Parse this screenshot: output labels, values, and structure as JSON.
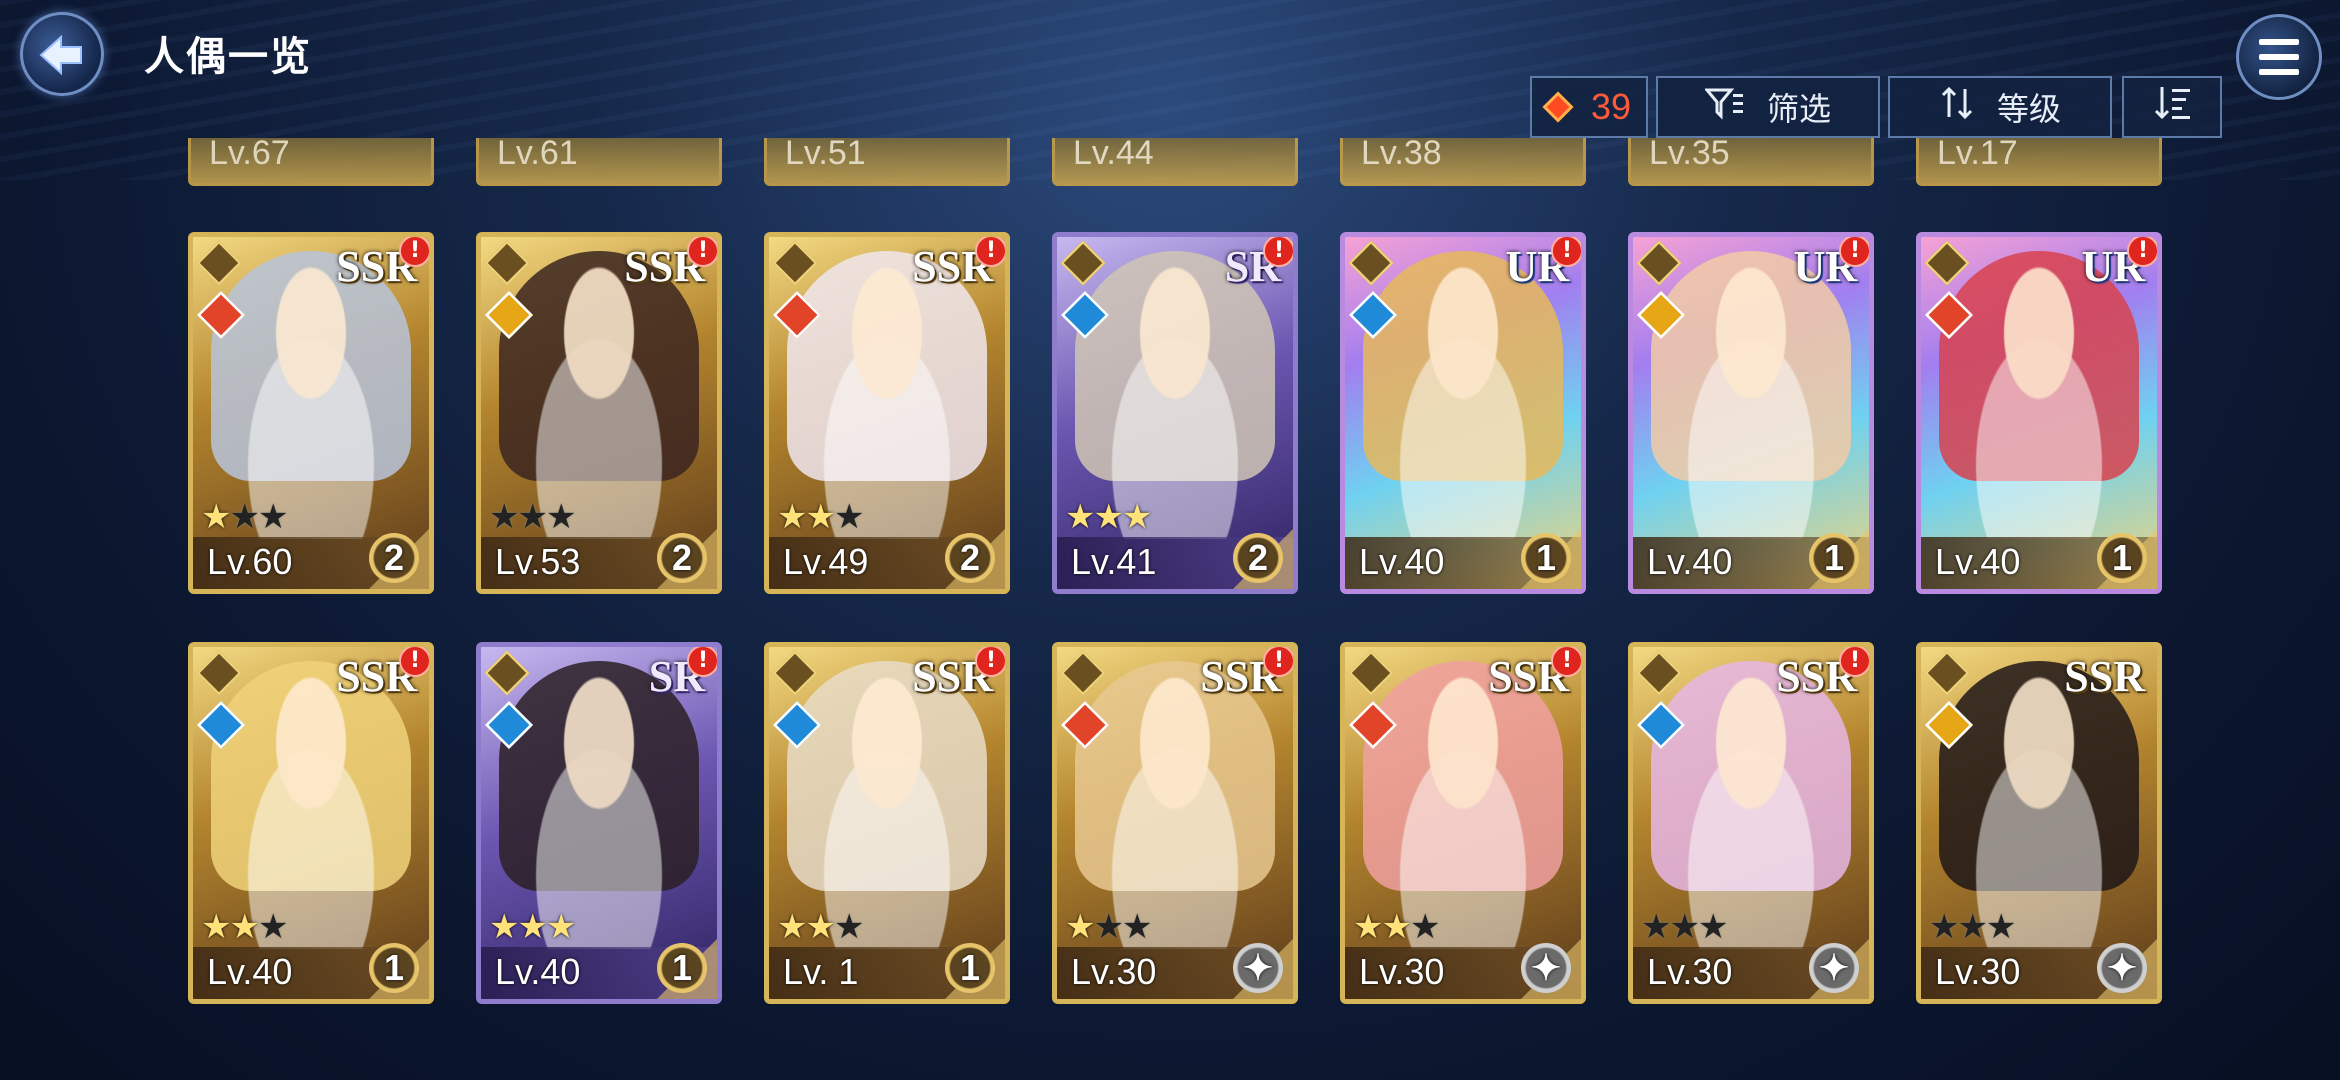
{
  "header": {
    "title": "人偶一览",
    "back_icon": "back-arrow-icon",
    "menu_icon": "hamburger-menu-icon"
  },
  "toolbar": {
    "currency_value": "39",
    "filter_label": "筛选",
    "sort_label": "等级",
    "order_icon": "sort-descending-icon"
  },
  "top_row_levels": [
    "Lv.67",
    "Lv.61",
    "Lv.51",
    "Lv.44",
    "Lv.38",
    "Lv.35",
    "Lv.17"
  ],
  "cards": [
    {
      "level": "Lv.60",
      "rarity": "SSR",
      "badge": "2",
      "stars_on": 1,
      "element": "fire",
      "frame": "gold",
      "hair": "#b7c4da"
    },
    {
      "level": "Lv.53",
      "rarity": "SSR",
      "badge": "2",
      "stars_on": 0,
      "element": "earth",
      "frame": "gold",
      "hair": "#3b2420"
    },
    {
      "level": "Lv.49",
      "rarity": "SSR",
      "badge": "2",
      "stars_on": 2,
      "element": "fire",
      "frame": "gold",
      "hair": "#f0e6ee"
    },
    {
      "level": "Lv.41",
      "rarity": "SR",
      "badge": "2",
      "stars_on": 3,
      "element": "water",
      "frame": "purple",
      "hair": "#cfc6b4"
    },
    {
      "level": "Lv.40",
      "rarity": "UR",
      "badge": "1",
      "stars_on": 0,
      "element": "water",
      "frame": "rainbow",
      "hair": "#e6b85a"
    },
    {
      "level": "Lv.40",
      "rarity": "UR",
      "badge": "1",
      "stars_on": 0,
      "element": "earth",
      "frame": "rainbow",
      "hair": "#f2caa6"
    },
    {
      "level": "Lv.40",
      "rarity": "UR",
      "badge": "1",
      "stars_on": 0,
      "element": "fire",
      "frame": "rainbow",
      "hair": "#d8424e"
    },
    {
      "level": "Lv.40",
      "rarity": "SSR",
      "badge": "1",
      "stars_on": 2,
      "element": "water",
      "frame": "gold",
      "hair": "#f0d27a"
    },
    {
      "level": "Lv.40",
      "rarity": "SR",
      "badge": "1",
      "stars_on": 3,
      "element": "water",
      "frame": "purple",
      "hair": "#2a2024"
    },
    {
      "level": "Lv. 1",
      "rarity": "SSR",
      "badge": "1",
      "stars_on": 2,
      "element": "water",
      "frame": "gold",
      "hair": "#e8dcc8"
    },
    {
      "level": "Lv.30",
      "rarity": "SSR",
      "badge": "",
      "stars_on": 1,
      "element": "fire",
      "frame": "gold",
      "hair": "#e8c890"
    },
    {
      "level": "Lv.30",
      "rarity": "SSR",
      "badge": "",
      "stars_on": 2,
      "element": "fire",
      "frame": "gold",
      "hair": "#f0a0a0"
    },
    {
      "level": "Lv.30",
      "rarity": "SSR",
      "badge": "",
      "stars_on": 0,
      "element": "water",
      "frame": "gold",
      "hair": "#e6b6e6"
    },
    {
      "level": "Lv.30",
      "rarity": "SSR",
      "badge": "",
      "stars_on": 0,
      "element": "earth",
      "frame": "gold",
      "hair": "#1e1618"
    }
  ]
}
